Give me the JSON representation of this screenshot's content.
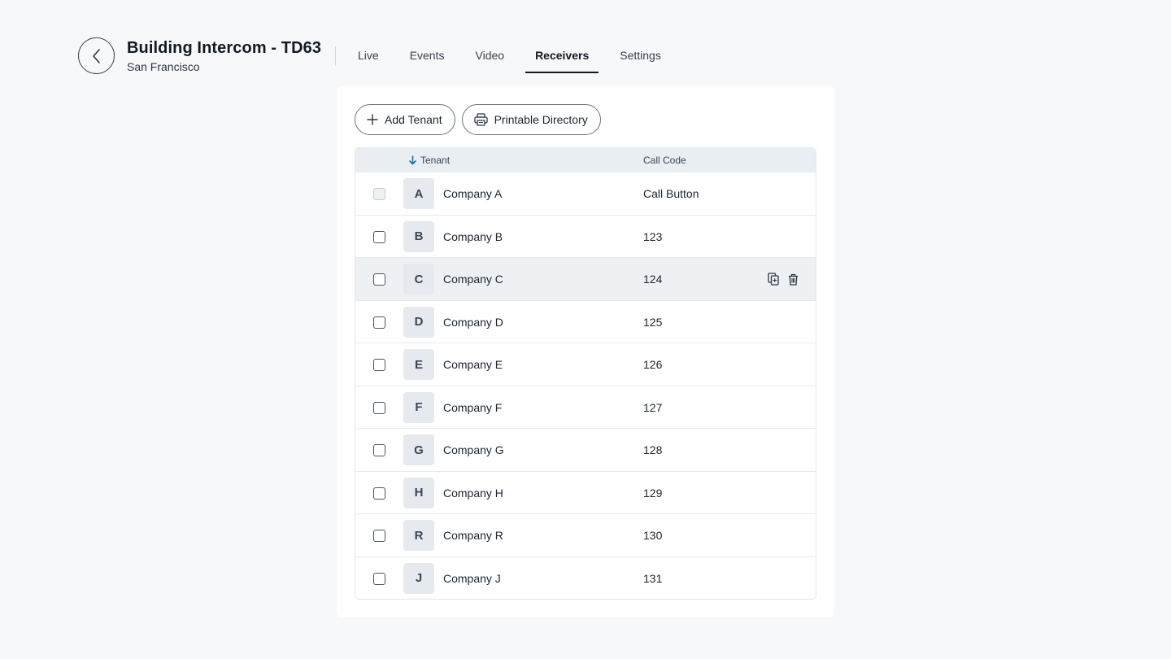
{
  "header": {
    "title": "Building Intercom - TD63",
    "subtitle": "San Francisco",
    "back_icon": "chevron-left-icon"
  },
  "tabs": [
    {
      "label": "Live",
      "active": false
    },
    {
      "label": "Events",
      "active": false
    },
    {
      "label": "Video",
      "active": false
    },
    {
      "label": "Receivers",
      "active": true
    },
    {
      "label": "Settings",
      "active": false
    }
  ],
  "toolbar": {
    "add_tenant_label": "Add Tenant",
    "add_tenant_icon": "plus-icon",
    "printable_directory_label": "Printable Directory",
    "printable_directory_icon": "printer-icon"
  },
  "table": {
    "columns": {
      "tenant": "Tenant",
      "call_code": "Call Code"
    },
    "sort_icon": "arrow-down-icon",
    "rows": [
      {
        "initial": "A",
        "name": "Company A",
        "code": "Call Button",
        "checkbox_disabled": true
      },
      {
        "initial": "B",
        "name": "Company B",
        "code": "123"
      },
      {
        "initial": "C",
        "name": "Company C",
        "code": "124",
        "hovered": true
      },
      {
        "initial": "D",
        "name": "Company D",
        "code": "125"
      },
      {
        "initial": "E",
        "name": "Company E",
        "code": "126"
      },
      {
        "initial": "F",
        "name": "Company F",
        "code": "127"
      },
      {
        "initial": "G",
        "name": "Company G",
        "code": "128"
      },
      {
        "initial": "H",
        "name": "Company H",
        "code": "129"
      },
      {
        "initial": "R",
        "name": "Company R",
        "code": "130"
      },
      {
        "initial": "J",
        "name": "Company J",
        "code": "131"
      }
    ],
    "row_action_icons": [
      "copy-icon",
      "trash-icon"
    ]
  },
  "colors": {
    "background": "#f6f8fa",
    "accent": "#1a6fa8",
    "header_row": "#e9eef2"
  }
}
